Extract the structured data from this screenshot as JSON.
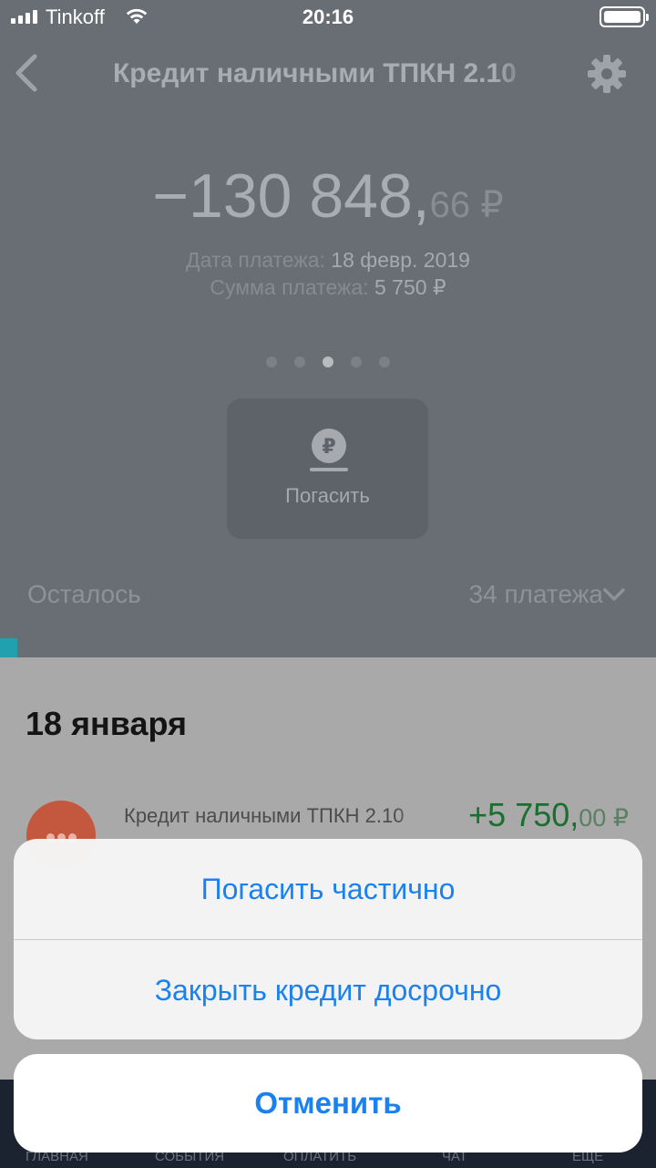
{
  "status_bar": {
    "carrier": "Tinkoff",
    "time": "20:16"
  },
  "nav": {
    "title": "Кредит наличными ТПКН 2.10"
  },
  "balance": {
    "integer": "−130 848,",
    "fraction": "66 ₽"
  },
  "payment": {
    "date_label": "Дата платежа:",
    "date_value": "18 февр. 2019",
    "sum_label": "Сумма платежа:",
    "sum_value": "5 750 ₽"
  },
  "pager": {
    "count": 5,
    "active_index": 2
  },
  "repay": {
    "label": "Погасить",
    "icon": "ruble-coin-icon"
  },
  "remaining": {
    "label": "Осталось",
    "count": "34 платежа"
  },
  "feed": {
    "date_heading": "18 января",
    "transaction": {
      "title": "Кредит наличными ТПКН 2.10",
      "amount_integer": "+5 750,",
      "amount_fraction": "00 ₽",
      "avatar_color": "#c4583f"
    }
  },
  "tabbar": {
    "tabs": [
      "ГЛАВНАЯ",
      "СОБЫТИЯ",
      "ОПЛАТИТЬ",
      "ЧАТ",
      "ЕЩЁ"
    ]
  },
  "action_sheet": {
    "option_partial": "Погасить частично",
    "option_close": "Закрыть кредит досрочно",
    "cancel": "Отменить",
    "accent_color": "#1a82f0"
  }
}
